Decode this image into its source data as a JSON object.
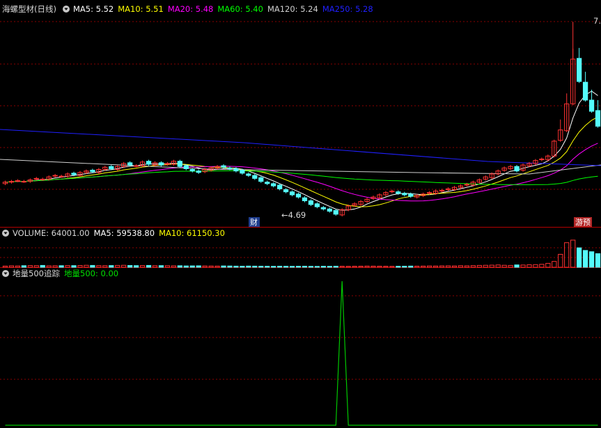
{
  "price_panel": {
    "title": "海螺型材(日线)",
    "mas": [
      {
        "label": "MA5: 5.52",
        "color": "#ffffff"
      },
      {
        "label": "MA10: 5.51",
        "color": "#ffff00"
      },
      {
        "label": "MA20: 5.48",
        "color": "#ff00ff"
      },
      {
        "label": "MA60: 5.40",
        "color": "#00ff00"
      },
      {
        "label": "MA120: 5.24",
        "color": "#d0d0d0"
      },
      {
        "label": "MA250: 5.28",
        "color": "#2020ff"
      }
    ],
    "low_label": "←4.69",
    "high_label": "7.",
    "marker_cai": "财",
    "marker_xiaji": "游预"
  },
  "volume_panel": {
    "label": "VOLUME: 64001.00",
    "mas": [
      {
        "label": "MA5: 59538.80",
        "color": "#ffffff"
      },
      {
        "label": "MA10: 61150.30",
        "color": "#ffff00"
      }
    ]
  },
  "indicator_panel": {
    "title": "地量500追踪",
    "value_label": "地量500: 0.00"
  },
  "colors": {
    "up": "#ff3232",
    "down": "#54fcfc",
    "grid": "#8c0000",
    "indicator_line": "#00c800",
    "panel_border": "#b40000"
  },
  "chart_data": [
    {
      "type": "candlestick",
      "title": "海螺型材(日线)",
      "ylim": [
        4.55,
        7.35
      ],
      "low": 4.69,
      "high": 7.3,
      "close_series": [
        5.15,
        5.16,
        5.17,
        5.16,
        5.18,
        5.2,
        5.19,
        5.22,
        5.24,
        5.23,
        5.26,
        5.25,
        5.28,
        5.3,
        5.29,
        5.32,
        5.35,
        5.33,
        5.36,
        5.4,
        5.38,
        5.37,
        5.42,
        5.39,
        5.41,
        5.38,
        5.4,
        5.43,
        5.36,
        5.33,
        5.3,
        5.28,
        5.32,
        5.34,
        5.36,
        5.35,
        5.33,
        5.3,
        5.27,
        5.24,
        5.2,
        5.16,
        5.13,
        5.1,
        5.06,
        5.02,
        4.98,
        4.95,
        4.9,
        4.85,
        4.82,
        4.79,
        4.76,
        4.72,
        4.78,
        4.83,
        4.86,
        4.89,
        4.92,
        4.95,
        4.98,
        5.01,
        5.03,
        5.0,
        4.98,
        4.96,
        4.97,
        4.99,
        5.01,
        5.03,
        5.04,
        5.06,
        5.08,
        5.1,
        5.12,
        5.15,
        5.18,
        5.22,
        5.26,
        5.3,
        5.34,
        5.36,
        5.3,
        5.38,
        5.4,
        5.44,
        5.46,
        5.5,
        5.7,
        5.85,
        6.2,
        6.8,
        6.5,
        6.25,
        6.1,
        5.9
      ]
    },
    {
      "type": "bar",
      "title": "VOLUME",
      "value": 64001.0,
      "ma5": 59538.8,
      "ma10": 61150.3,
      "values": [
        18,
        22,
        20,
        24,
        26,
        25,
        28,
        22,
        23,
        24,
        26,
        25,
        27,
        30,
        28,
        25,
        24,
        26,
        28,
        30,
        27,
        25,
        26,
        28,
        24,
        25,
        24,
        22,
        23,
        20,
        21,
        22,
        20,
        19,
        18,
        20,
        19,
        17,
        16,
        18,
        17,
        16,
        15,
        14,
        16,
        15,
        14,
        15,
        16,
        14,
        13,
        15,
        14,
        16,
        15,
        14,
        15,
        16,
        18,
        17,
        16,
        15,
        14,
        15,
        16,
        18,
        17,
        18,
        20,
        19,
        21,
        22,
        20,
        24,
        22,
        25,
        28,
        30,
        32,
        35,
        30,
        28,
        36,
        34,
        38,
        40,
        45,
        60,
        90,
        200,
        380,
        420,
        300,
        260,
        240,
        210
      ]
    },
    {
      "type": "line",
      "title": "地量500追踪",
      "series": [
        {
          "name": "地量500",
          "values": [
            0,
            0,
            0,
            0,
            0,
            0,
            0,
            0,
            0,
            0,
            0,
            0,
            0,
            0,
            0,
            0,
            0,
            0,
            0,
            0,
            0,
            0,
            0,
            0,
            0,
            0,
            0,
            0,
            0,
            0,
            0,
            0,
            0,
            0,
            0,
            0,
            0,
            0,
            0,
            0,
            0,
            0,
            0,
            0,
            0,
            0,
            0,
            0,
            0,
            0,
            0,
            0,
            0,
            0,
            1,
            0,
            0,
            0,
            0,
            0,
            0,
            0,
            0,
            0,
            0,
            0,
            0,
            0,
            0,
            0,
            0,
            0,
            0,
            0,
            0,
            0,
            0,
            0,
            0,
            0,
            0,
            0,
            0,
            0,
            0,
            0,
            0,
            0,
            0,
            0,
            0,
            0,
            0,
            0,
            0,
            0
          ]
        }
      ],
      "ylim": [
        0,
        1
      ]
    }
  ]
}
